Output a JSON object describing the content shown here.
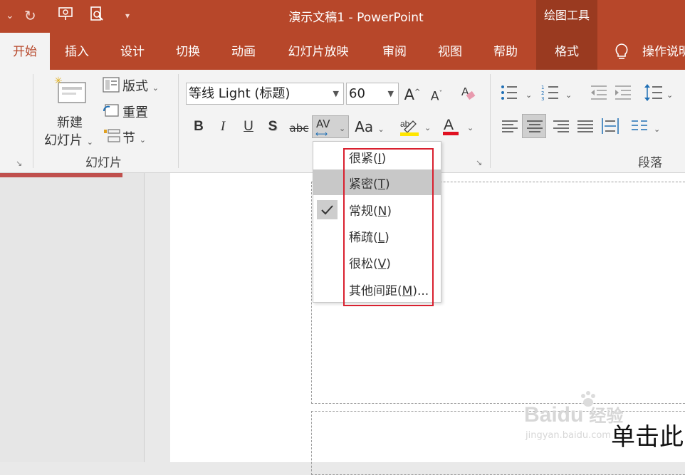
{
  "titlebar": {
    "title": "演示文稿1  -  PowerPoint",
    "contextual_group": "绘图工具"
  },
  "tabs": [
    {
      "label": "开始",
      "active": true
    },
    {
      "label": "插入"
    },
    {
      "label": "设计"
    },
    {
      "label": "切换"
    },
    {
      "label": "动画"
    },
    {
      "label": "幻灯片放映"
    },
    {
      "label": "审阅"
    },
    {
      "label": "视图"
    },
    {
      "label": "帮助"
    },
    {
      "label": "格式",
      "contextual": true
    }
  ],
  "tell_me": "操作说明",
  "slides_group": {
    "new_slide_line1": "新建",
    "new_slide_line2": "幻灯片",
    "layout": "版式",
    "reset": "重置",
    "section": "节",
    "group_label": "幻灯片"
  },
  "font_group": {
    "font_name": "等线 Light (标题)",
    "font_size": "60",
    "bold": "B",
    "italic": "I",
    "underline": "U",
    "shadow": "S",
    "strike": "abc",
    "spacing": "AV",
    "case": "Aa",
    "grow": "A",
    "shrink": "A"
  },
  "paragraph_group": {
    "group_label": "段落"
  },
  "spacing_menu": {
    "items": [
      {
        "label": "很紧",
        "key": "I"
      },
      {
        "label": "紧密",
        "key": "T",
        "highlighted": true
      },
      {
        "label": "常规",
        "key": "N",
        "checked": true
      },
      {
        "label": "稀疏",
        "key": "L"
      },
      {
        "label": "很松",
        "key": "V"
      },
      {
        "label": "其他间距",
        "key": "M",
        "suffix": "..."
      }
    ]
  },
  "slide": {
    "subtitle_fragment": "单击此"
  },
  "watermark": {
    "brand": "Baidu",
    "brand_suffix": "经验",
    "url": "jingyan.baidu.com"
  },
  "colors": {
    "accent": "#b7472a",
    "contextual": "#9a3a20",
    "highlight_marker": "#d9202f"
  }
}
